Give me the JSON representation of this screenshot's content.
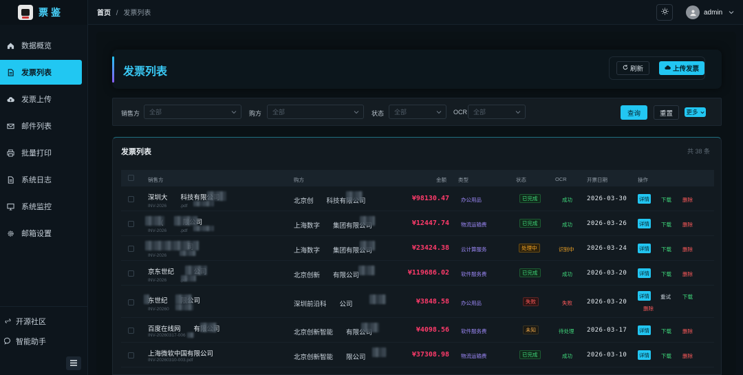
{
  "app": {
    "brand": "票鉴"
  },
  "sidebar": {
    "items": [
      {
        "label": "数据概览",
        "icon": "home-icon"
      },
      {
        "label": "发票列表",
        "icon": "document-icon",
        "active": true
      },
      {
        "label": "发票上传",
        "icon": "cloud-upload-icon"
      },
      {
        "label": "邮件列表",
        "icon": "mail-icon"
      },
      {
        "label": "批量打印",
        "icon": "printer-icon"
      },
      {
        "label": "系统日志",
        "icon": "log-icon"
      },
      {
        "label": "系统监控",
        "icon": "monitor-icon"
      },
      {
        "label": "邮箱设置",
        "icon": "gear-icon"
      }
    ],
    "bottom": [
      {
        "label": "开源社区",
        "icon": "link-icon"
      },
      {
        "label": "智能助手",
        "icon": "chat-icon"
      }
    ]
  },
  "topbar": {
    "crumb_home": "首页",
    "crumb_sep": "/",
    "crumb_current": "发票列表",
    "username": "admin"
  },
  "hero": {
    "title": "发票列表",
    "refresh_label": "刷新",
    "upload_label": "上传发票"
  },
  "filters": {
    "seller_label": "销售方",
    "seller_value": "全部",
    "buyer_label": "购方",
    "buyer_value": "全部",
    "status_label": "状态",
    "status_value": "全部",
    "ocr_label": "OCR",
    "ocr_value": "全部",
    "query_label": "查询",
    "reset_label": "重置",
    "more_label": "更多"
  },
  "list": {
    "title": "发票列表",
    "total": "共 38 条",
    "columns": {
      "seller": "销售方",
      "buyer": "购方",
      "amount": "金额",
      "type": "类型",
      "status": "状态",
      "ocr": "OCR",
      "date": "开票日期",
      "actions": "操作"
    },
    "action_detail": "详情",
    "action_download": "下载",
    "action_delete": "删除",
    "action_retry": "重试",
    "rows": [
      {
        "seller": "深圳大　　科技有限公司",
        "invno": "INV-2026　　　.pdf",
        "buyer": "北京创　　科技有限公司",
        "amount": "¥98130.47",
        "type": "办公用品",
        "status": "已完成",
        "status_kind": "done",
        "ocr": "成功",
        "ocr_color": "#3fd67a",
        "date": "2026-03-30"
      },
      {
        "seller": "　　(　　　限公司",
        "invno": "INV-2026　　　.pdf",
        "buyer": "上海数字　　集团有限公司",
        "amount": "¥12447.74",
        "type": "物流运输费",
        "status": "已完成",
        "status_kind": "done",
        "ocr": "成功",
        "ocr_color": "#3fd67a",
        "date": "2026-03-26"
      },
      {
        "seller": "　　　　　　司",
        "invno": "INV-2026　　　",
        "buyer": "上海数字　　集团有限公司",
        "amount": "¥23424.38",
        "type": "云计算服务",
        "status": "处理中",
        "status_kind": "proc",
        "ocr": "识别中",
        "ocr_color": "#f5a623",
        "date": "2026-03-24"
      },
      {
        "seller": "京东世纪　　　公司",
        "invno": "INV-2026　　　.pdf",
        "buyer": "北京创新　　有限公司",
        "amount": "¥119686.02",
        "type": "软件服务费",
        "status": "已完成",
        "status_kind": "done",
        "ocr": "成功",
        "ocr_color": "#3fd67a",
        "date": "2026-03-20"
      },
      {
        "seller": "东世纪　　限公司",
        "invno": "INV-20260　　",
        "buyer": "深圳前沿科　　公司",
        "amount": "¥3848.58",
        "type": "办公用品",
        "status": "失败",
        "status_kind": "fail",
        "ocr": "失败",
        "ocr_color": "#ff5a5a",
        "date": "2026-03-20",
        "retry": true
      },
      {
        "seller": "百度在线网　　有限公司",
        "invno": "INV-20260317-006",
        "buyer": "北京创新智能　　有限公司",
        "amount": "¥4098.56",
        "type": "软件服务费",
        "status": "未知",
        "status_kind": "unk",
        "ocr": "待处理",
        "ocr_color": "#3fd67a",
        "date": "2026-03-17"
      },
      {
        "seller": "上海微软中国有限公司",
        "invno": "INV-20260310-003.pdf",
        "buyer": "北京创新智能　　限公司",
        "amount": "¥37308.98",
        "type": "物流运输费",
        "status": "已完成",
        "status_kind": "done",
        "ocr": "成功",
        "ocr_color": "#3fd67a",
        "date": "2026-03-10"
      }
    ]
  },
  "colors": {
    "accent": "#22c6f2",
    "amount": "#ff3b6b",
    "success": "#3fd67a",
    "danger": "#ff5a5a",
    "warning": "#f5a623",
    "type_text": "#9b87f5"
  }
}
